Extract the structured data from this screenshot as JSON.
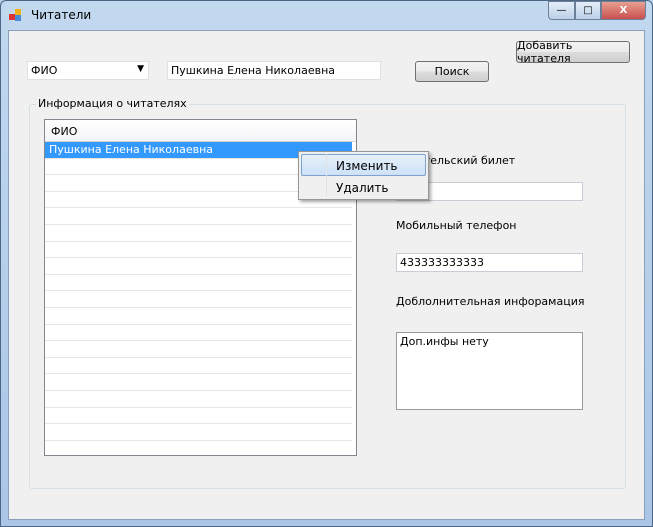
{
  "window": {
    "title": "Читатели",
    "minimize": "—",
    "maximize": "□",
    "close": "X"
  },
  "search": {
    "field_select": "ФИО",
    "query": "Пушкина Елена Николаевна",
    "search_button": "Поиск",
    "add_button": "Добавить читателя"
  },
  "group": {
    "title": "Информация о читателях"
  },
  "list": {
    "header": "ФИО",
    "rows": [
      "Пушкина Елена Николаевна"
    ],
    "selected_index": 0
  },
  "context_menu": {
    "items": [
      "Изменить",
      "Удалить"
    ],
    "highlighted": "Изменить"
  },
  "details": {
    "ticket_label": "Читательский билет",
    "ticket_value": "",
    "phone_label": "Мобильный телефон",
    "phone_value": "433333333333",
    "extra_label": "Доблолнительная инфорамация",
    "extra_value": "Доп.инфы нету"
  },
  "colors": {
    "selection": "#3399ff",
    "close": "#c75050"
  }
}
